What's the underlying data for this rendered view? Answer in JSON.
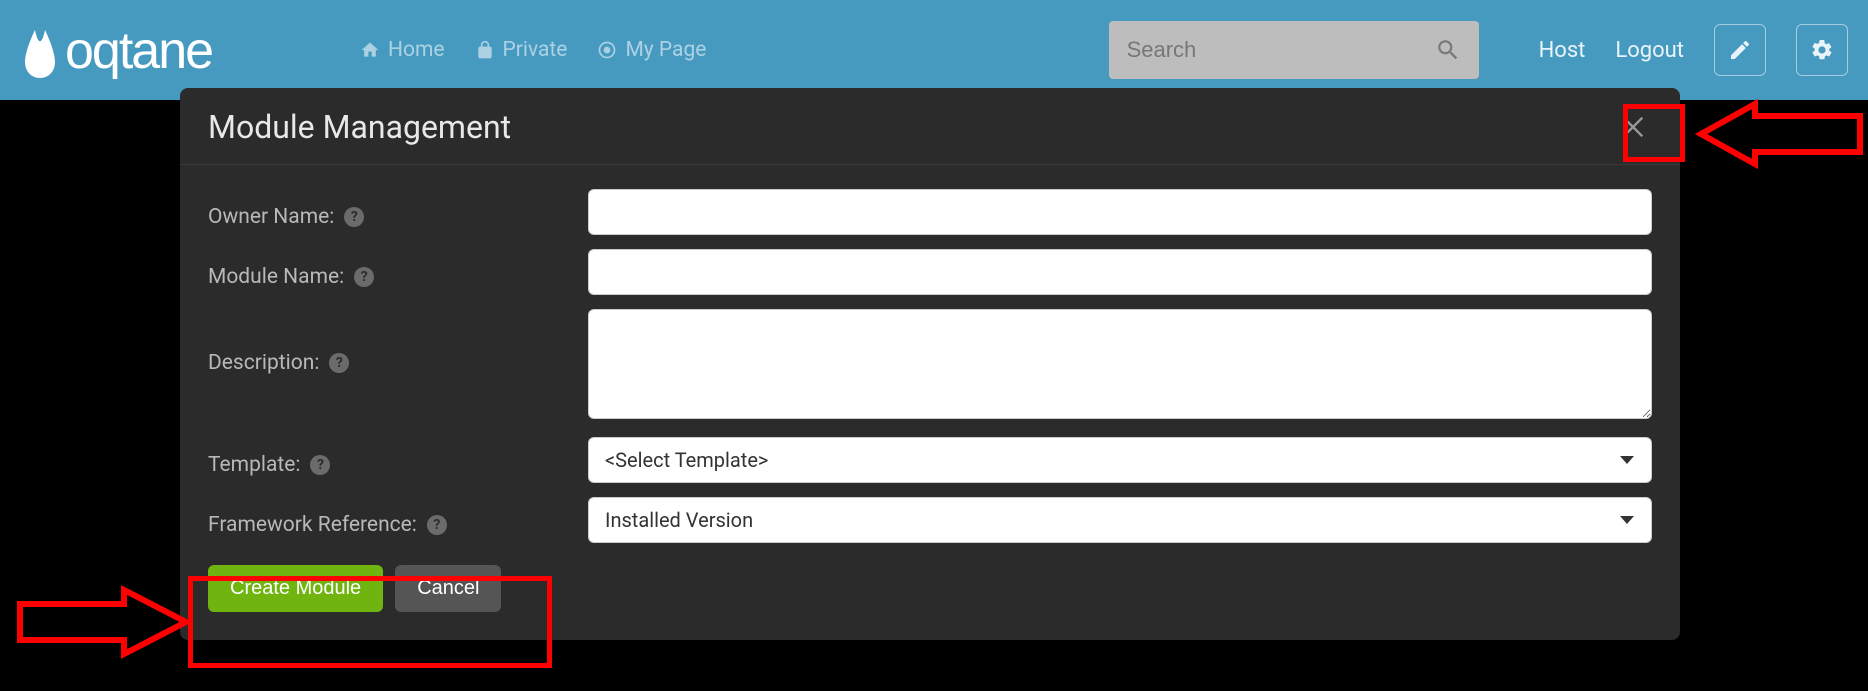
{
  "brand": "oqtane",
  "nav": {
    "home": "Home",
    "private": "Private",
    "mypage": "My Page"
  },
  "search": {
    "placeholder": "Search"
  },
  "links": {
    "host": "Host",
    "logout": "Logout"
  },
  "modal": {
    "title": "Module Management",
    "labels": {
      "owner": "Owner Name:",
      "module": "Module Name:",
      "description": "Description:",
      "template": "Template:",
      "framework": "Framework Reference:"
    },
    "template_selected": "<Select Template>",
    "framework_selected": "Installed Version",
    "buttons": {
      "create": "Create Module",
      "cancel": "Cancel"
    }
  }
}
